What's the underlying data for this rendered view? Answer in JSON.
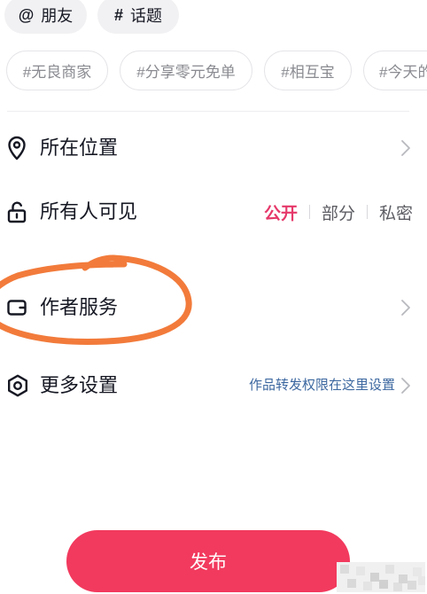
{
  "top_chips": [
    {
      "symbol": "@",
      "label": "朋友",
      "icon": "at-icon"
    },
    {
      "symbol": "#",
      "label": "话题",
      "icon": "hash-icon"
    }
  ],
  "hashtags": [
    {
      "label": "#无良商家"
    },
    {
      "label": "#分享零元免单"
    },
    {
      "label": "#相互宝"
    },
    {
      "label": "#今天的"
    }
  ],
  "settings": {
    "location": {
      "label": "所在位置",
      "icon": "location-pin-icon"
    },
    "visibility": {
      "label": "所有人可见",
      "icon": "unlock-icon",
      "options": [
        {
          "label": "公开",
          "selected": true
        },
        {
          "label": "部分",
          "selected": false
        },
        {
          "label": "私密",
          "selected": false
        }
      ]
    },
    "author_service": {
      "label": "作者服务",
      "icon": "wallet-icon"
    },
    "more_settings": {
      "label": "更多设置",
      "icon": "settings-icon",
      "hint": "作品转发权限在这里设置"
    }
  },
  "publish_button": {
    "label": "发布"
  },
  "colors": {
    "accent": "#f23a5e",
    "selected_option": "#e6386a",
    "hint_link": "#3d68a0",
    "annotation": "#f27b3b",
    "text_primary": "#161823",
    "text_secondary": "#8a8b91"
  }
}
